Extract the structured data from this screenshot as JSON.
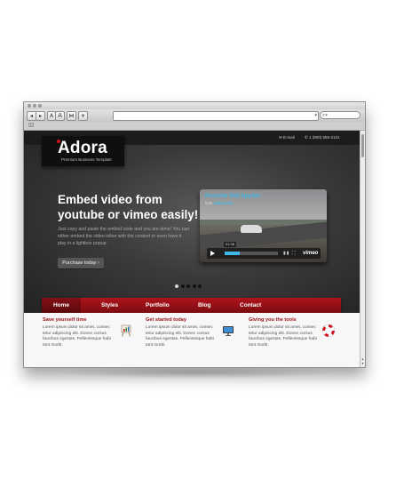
{
  "browser": {
    "toolbar": {
      "back": "◂",
      "forward": "▸",
      "text_smaller": "A",
      "text_bigger": "A",
      "stop": "⋈",
      "add": "+"
    },
    "search_icon": "search-icon"
  },
  "site": {
    "logo": "Adora",
    "tagline": "Premium Business Template",
    "contact": {
      "email": "E-mail",
      "phone": "1 (800) 555-2121"
    },
    "hero": {
      "headline": "Embed video from youtube or vimeo easily!",
      "body": "Just copy and paste the embed code and you are done! You can either embed the video inline with the content or even have it play in a lightbox popup.",
      "button": "Purchase today ›"
    },
    "video": {
      "title": "Porsche 918 Spyder",
      "from_prefix": "from",
      "author": "Gallo Kirel",
      "time": "01:38",
      "progress": 0.28,
      "brand": "vimeo"
    },
    "slider": {
      "count": 5,
      "active_index": 0
    },
    "nav": [
      "Home",
      "Styles",
      "Portfolio",
      "Blog",
      "Contact"
    ],
    "columns": [
      {
        "title": "Save yourself time",
        "text": "Lorem ipsum dolor sit amet, consec tetur adipiscing elit. Donec cursus faucibus egestas. Pellentesque habi tant morbi.",
        "icon": "easel-chart-icon"
      },
      {
        "title": "Get started today",
        "text": "Lorem ipsum dolor sit amet, consec tetur adipiscing elit. Donec cursus faucibus egestas. Pellentesque habi tant morbi.",
        "icon": "monitor-icon"
      },
      {
        "title": "Giving you the tools",
        "text": "Lorem ipsum dolor sit amet, consec tetur adipiscing elit. Donec cursus faucibus egestas. Pellentesque habi tant morbi.",
        "icon": "lifebuoy-icon"
      }
    ]
  },
  "colors": {
    "accent_red": "#9a1016",
    "nav_red": "#b0141b",
    "video_blue": "#3fb8e8"
  }
}
